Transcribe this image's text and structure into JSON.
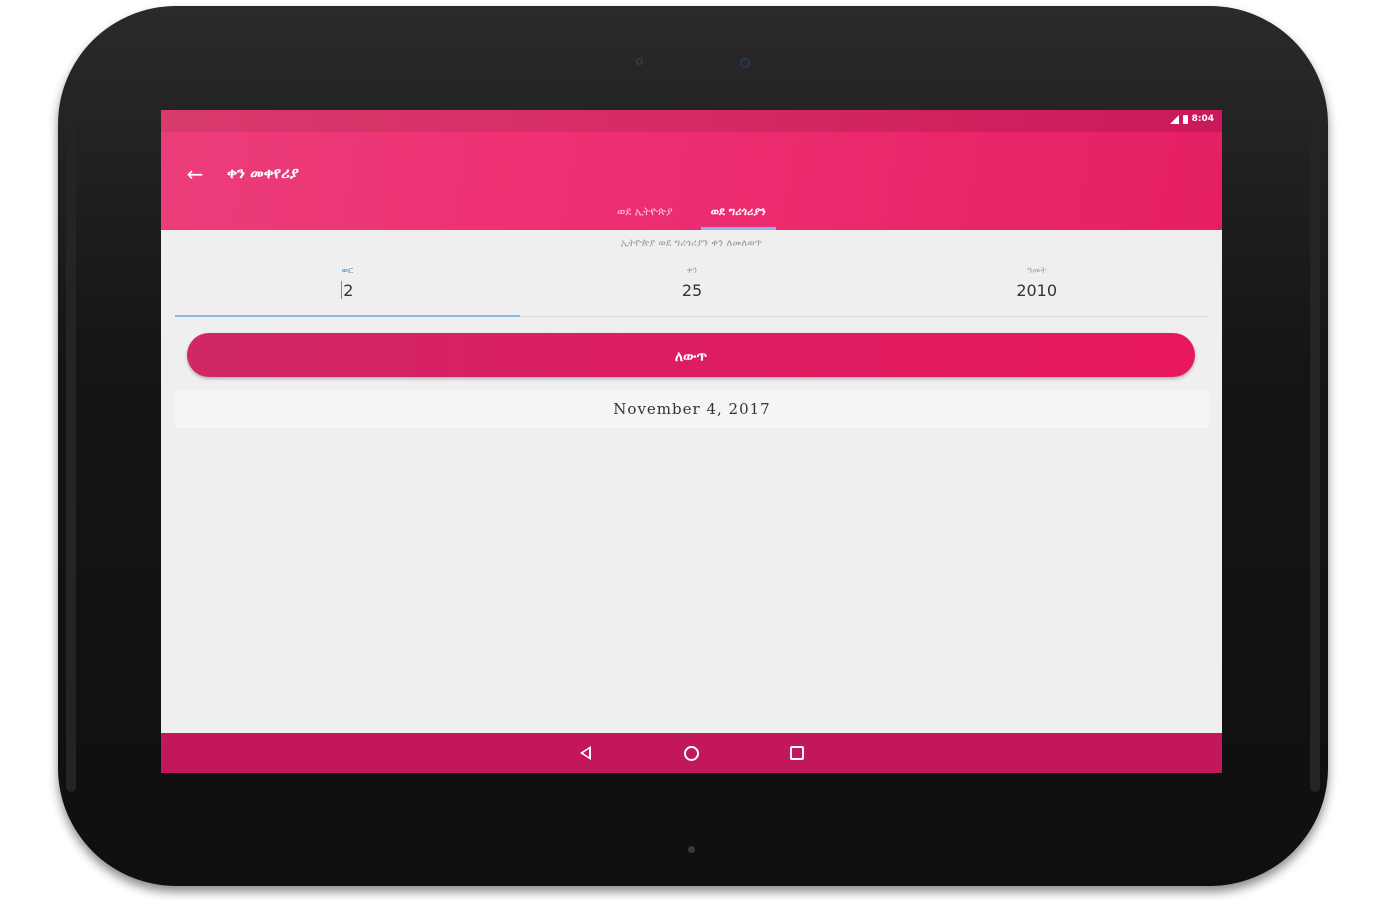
{
  "status_bar": {
    "time": "8:04"
  },
  "app_bar": {
    "title": "ቀን መቀየሪያ",
    "back_icon": "arrow-back-icon"
  },
  "tabs": [
    {
      "label": "ወደ ኢትዮጵያ",
      "active": false
    },
    {
      "label": "ወደ ግሪጎሪያን",
      "active": true
    }
  ],
  "subtitle": "ኢትዮጵያ ወደ ግሪጎሪያን ቀን ለመለወጥ",
  "fields": [
    {
      "label": "ወር",
      "value": "2",
      "focused": true
    },
    {
      "label": "ቀን",
      "value": "25",
      "focused": false
    },
    {
      "label": "ዓመት",
      "value": "2010",
      "focused": false
    }
  ],
  "convert_button": {
    "label": "ለውጥ"
  },
  "result": {
    "text": "November 4, 2017"
  },
  "nav_bar": {
    "back_icon": "nav-back-icon",
    "home_icon": "nav-home-icon",
    "recent_icon": "nav-recent-icon"
  },
  "colors": {
    "primary": "#e91e63",
    "primary_dark": "#c2185b",
    "accent": "#8bb4ee",
    "background": "#efefef"
  }
}
